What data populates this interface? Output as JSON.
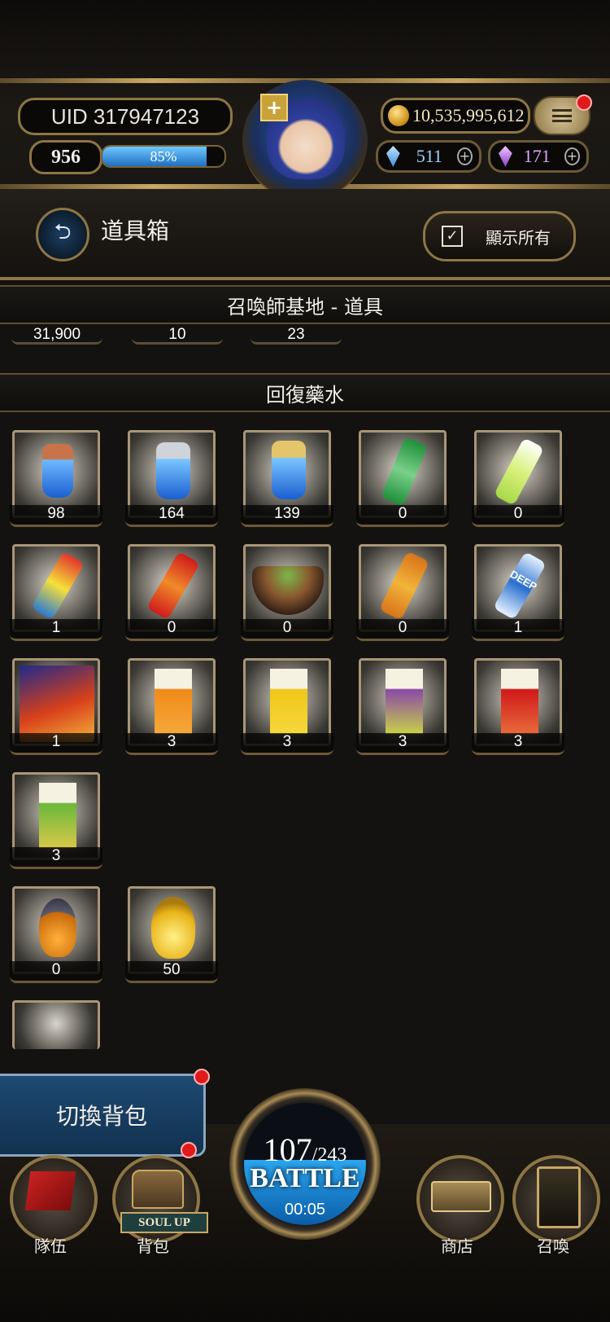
{
  "header": {
    "uid_text": "UID 317947123",
    "level": "956",
    "exp_percent_text": "85%",
    "exp_fraction": 0.85,
    "gold": "10,535,995,612",
    "blue_gems": "511",
    "purple_gems": "171"
  },
  "titlebar": {
    "title": "道具箱",
    "show_all_label": "顯示所有"
  },
  "section_base": {
    "title": "召喚師基地 - 道具",
    "counts": [
      "31,900",
      "10",
      "23"
    ]
  },
  "section_potions": {
    "title": "回復藥水",
    "items": [
      {
        "name": "blue-potion-small",
        "count": "98"
      },
      {
        "name": "blue-potion-medium",
        "count": "164"
      },
      {
        "name": "blue-potion-large",
        "count": "139"
      },
      {
        "name": "green-soda-bottle",
        "count": "0"
      },
      {
        "name": "green-tea-bottle",
        "count": "0"
      },
      {
        "name": "yellow-juice-bottle",
        "count": "1"
      },
      {
        "name": "red-tea-bottle",
        "count": "0"
      },
      {
        "name": "beef-rice-bowl",
        "count": "0"
      },
      {
        "name": "orange-tea-bottle",
        "count": "0"
      },
      {
        "name": "deep-water-bottle",
        "count": "1",
        "label": "DEEP"
      },
      {
        "name": "snack-chips-bag",
        "count": "1"
      },
      {
        "name": "orange-milk-tea-carton",
        "count": "3"
      },
      {
        "name": "yellow-jasmine-tea-carton",
        "count": "3"
      },
      {
        "name": "purple-fruit-tea-carton",
        "count": "3"
      },
      {
        "name": "red-apple-tea-carton",
        "count": "3"
      },
      {
        "name": "green-lemon-tea-carton",
        "count": "3"
      },
      {
        "name": "orange-elixir-flask",
        "count": "0"
      },
      {
        "name": "golden-elixir-flask",
        "count": "50"
      }
    ]
  },
  "bottom": {
    "switch_bag_label": "切換背包",
    "battle_current": "107",
    "battle_max": "/243",
    "battle_label": "BATTLE",
    "battle_timer": "00:05",
    "soul_up": "SOUL UP",
    "nav": {
      "team": "隊伍",
      "bag": "背包",
      "shop": "商店",
      "summon": "召喚"
    }
  },
  "colors": {
    "gold_accent": "#c9a765",
    "blue_accent": "#1f6fc0",
    "notification": "#e01a1a"
  }
}
